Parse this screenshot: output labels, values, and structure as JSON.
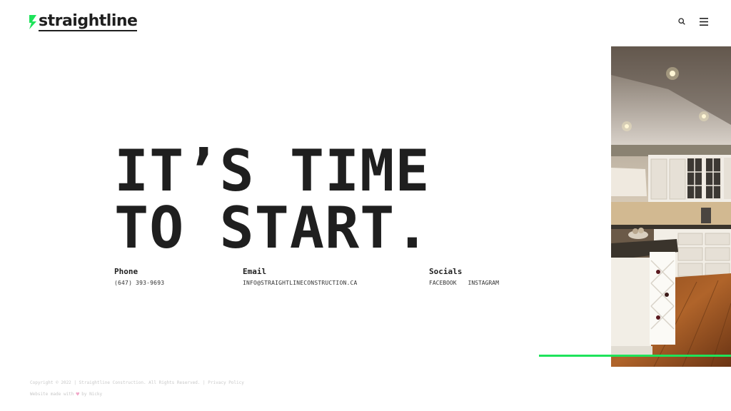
{
  "brand": {
    "name": "straightline",
    "accent_color": "#1ee35a"
  },
  "header": {
    "search_icon": "search-icon",
    "menu_icon": "hamburger-menu-icon"
  },
  "hero": {
    "line1": "IT’S TIME",
    "line2": "TO START."
  },
  "contact": {
    "phone": {
      "label": "Phone",
      "value": "(647) 393-9693"
    },
    "email": {
      "label": "Email",
      "value": "INFO@STRAIGHTLINECONSTRUCTION.CA"
    },
    "socials": {
      "label": "Socials",
      "links": [
        "FACEBOOK",
        "INSTAGRAM"
      ]
    }
  },
  "footer": {
    "copyright": "Copyright © 2022 | Straightline Construction. All Rights Reserved.",
    "separator": "|",
    "privacy": "Privacy Policy",
    "credit_prefix": "Website made with",
    "credit_suffix": "by Nicky"
  }
}
